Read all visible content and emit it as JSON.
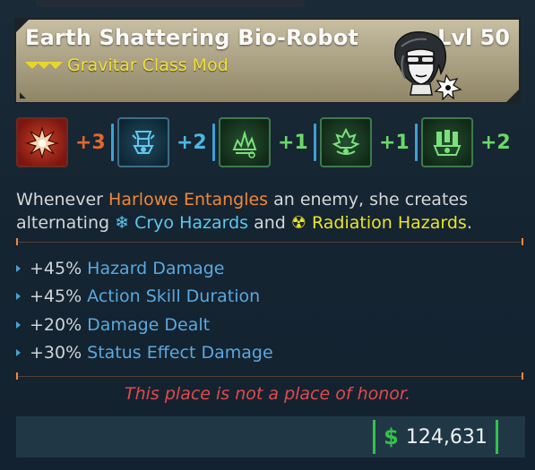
{
  "item": {
    "title": "Earth Shattering Bio-Robot",
    "level": "Lvl 50",
    "subtitle": "Gravitar Class Mod",
    "rarity_color": "#e9d628",
    "header_color": "#b3a98c"
  },
  "skills": [
    {
      "icon": "explosion-skill-icon",
      "bonus": "+3",
      "color": "#e0682e",
      "bg": "#8a1e14"
    },
    {
      "icon": "robot-skill-icon",
      "bonus": "+2",
      "color": "#4ab8e4",
      "bg": "#143444"
    },
    {
      "icon": "splash-skill-icon",
      "bonus": "+1",
      "color": "#6ad96a",
      "bg": "#173a24"
    },
    {
      "icon": "tree-skill-icon",
      "bonus": "+1",
      "color": "#6ad96a",
      "bg": "#173a24"
    },
    {
      "icon": "radiation-skill-icon",
      "bonus": "+2",
      "color": "#6ad96a",
      "bg": "#173a24"
    }
  ],
  "description": {
    "part1": "Whenever ",
    "harlowe": "Harlowe Entangles",
    "part2": " an enemy, she creates",
    "part3": "alternating ",
    "cryo": "Cryo Hazards",
    "part4": " and ",
    "radiation": "Radiation Hazards",
    "part5": "."
  },
  "stats": [
    {
      "value": "+45%",
      "name": "Hazard Damage"
    },
    {
      "value": "+45%",
      "name": "Action Skill Duration"
    },
    {
      "value": "+20%",
      "name": "Damage Dealt"
    },
    {
      "value": "+30%",
      "name": "Status Effect Damage"
    }
  ],
  "flavor": "This place is not a place of honor.",
  "price": {
    "currency": "$",
    "amount": "124,631"
  }
}
